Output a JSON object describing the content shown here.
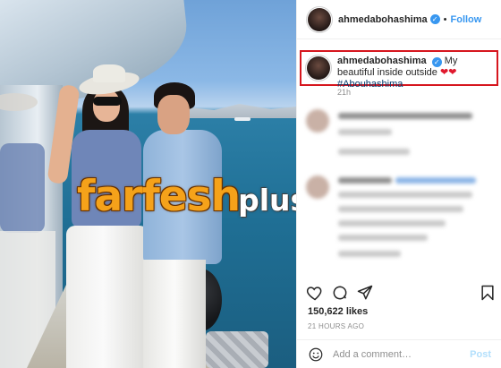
{
  "post": {
    "username": "ahmedabohashima",
    "verified_badge": "✓",
    "separator": "•",
    "follow_label": "Follow"
  },
  "caption": {
    "username": "ahmedabohashima",
    "text": "My beautiful inside outside",
    "hearts": "❤❤",
    "hashtag": "#Abouhashima",
    "time": "21h"
  },
  "watermark": {
    "main": "farfesh",
    "sub": "plus.com"
  },
  "engagement": {
    "likes": "150,622 likes",
    "time_ago": "21 HOURS AGO"
  },
  "comment_box": {
    "placeholder": "Add a comment…",
    "post_label": "Post"
  },
  "icons": [
    "heart-icon",
    "comment-icon",
    "share-icon",
    "bookmark-icon",
    "emoji-icon"
  ],
  "colors": {
    "accent_blue": "#3897f0",
    "highlight_red": "#d6161e",
    "watermark_orange": "#f5a21a"
  }
}
